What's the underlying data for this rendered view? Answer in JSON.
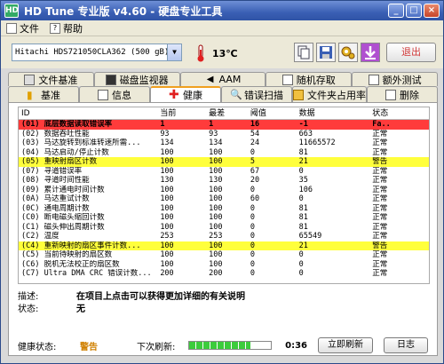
{
  "window": {
    "title": "HD Tune 专业版 v4.60 - 硬盘专业工具",
    "app_icon": "HD"
  },
  "menu": [
    {
      "label": "文件",
      "icon": "file-icon"
    },
    {
      "label": "帮助",
      "icon": "help-icon"
    }
  ],
  "toolbar": {
    "drive": "Hitachi HDS721050CLA362 (500 gB)",
    "temperature": "13℃",
    "exit_label": "退出"
  },
  "tabs_row1": [
    {
      "label": "文件基准",
      "icon": "file-benchmark-icon"
    },
    {
      "label": "磁盘监视器",
      "icon": "disk-monitor-icon"
    },
    {
      "label": "AAM",
      "icon": "speaker-icon"
    },
    {
      "label": "随机存取",
      "icon": "random-access-icon"
    },
    {
      "label": "额外测试",
      "icon": "extra-tests-icon"
    }
  ],
  "tabs_row2": [
    {
      "label": "基准",
      "icon": "benchmark-icon"
    },
    {
      "label": "信息",
      "icon": "info-icon"
    },
    {
      "label": "健康",
      "icon": "health-icon",
      "active": true
    },
    {
      "label": "错误扫描",
      "icon": "error-scan-icon"
    },
    {
      "label": "文件夹占用率",
      "icon": "folder-usage-icon"
    },
    {
      "label": "删除",
      "icon": "erase-icon"
    }
  ],
  "table": {
    "headers": [
      "ID",
      "当前",
      "最差",
      "阈值",
      "数据",
      "状态"
    ],
    "rows": [
      {
        "id": "(01) 底层数据读取错误率",
        "cur": "1",
        "worst": "1",
        "thr": "16",
        "data": "-1",
        "status": "Fa..",
        "hl": "red"
      },
      {
        "id": "(02) 数据吞吐性能",
        "cur": "93",
        "worst": "93",
        "thr": "54",
        "data": "663",
        "status": "正常"
      },
      {
        "id": "(03) 马达旋转到标准转速所需...",
        "cur": "134",
        "worst": "134",
        "thr": "24",
        "data": "11665572",
        "status": "正常"
      },
      {
        "id": "(04) 马达启动/停止计数",
        "cur": "100",
        "worst": "100",
        "thr": "0",
        "data": "81",
        "status": "正常"
      },
      {
        "id": "(05) 重映射扇区计数",
        "cur": "100",
        "worst": "100",
        "thr": "5",
        "data": "21",
        "status": "警告",
        "hl": "yellow"
      },
      {
        "id": "(07) 寻道错误率",
        "cur": "100",
        "worst": "100",
        "thr": "67",
        "data": "0",
        "status": "正常"
      },
      {
        "id": "(08) 寻道时间性能",
        "cur": "130",
        "worst": "130",
        "thr": "20",
        "data": "35",
        "status": "正常"
      },
      {
        "id": "(09) 累计通电时间计数",
        "cur": "100",
        "worst": "100",
        "thr": "0",
        "data": "106",
        "status": "正常"
      },
      {
        "id": "(0A) 马达重试计数",
        "cur": "100",
        "worst": "100",
        "thr": "60",
        "data": "0",
        "status": "正常"
      },
      {
        "id": "(0C) 通电周期计数",
        "cur": "100",
        "worst": "100",
        "thr": "0",
        "data": "81",
        "status": "正常"
      },
      {
        "id": "(C0) 断电磁头缩回计数",
        "cur": "100",
        "worst": "100",
        "thr": "0",
        "data": "81",
        "status": "正常"
      },
      {
        "id": "(C1) 磁头伸出周期计数",
        "cur": "100",
        "worst": "100",
        "thr": "0",
        "data": "81",
        "status": "正常"
      },
      {
        "id": "(C2) 温度",
        "cur": "253",
        "worst": "253",
        "thr": "0",
        "data": "65549",
        "status": "正常"
      },
      {
        "id": "(C4) 重新映射的扇区事件计数...",
        "cur": "100",
        "worst": "100",
        "thr": "0",
        "data": "21",
        "status": "警告",
        "hl": "yellow"
      },
      {
        "id": "(C5) 当前待映射的扇区数",
        "cur": "100",
        "worst": "100",
        "thr": "0",
        "data": "0",
        "status": "正常"
      },
      {
        "id": "(C6) 脱机无法校正的扇区数",
        "cur": "100",
        "worst": "100",
        "thr": "0",
        "data": "0",
        "status": "正常"
      },
      {
        "id": "(C7) Ultra DMA CRC 错误计数...",
        "cur": "200",
        "worst": "200",
        "thr": "0",
        "data": "0",
        "status": "正常"
      }
    ]
  },
  "description": {
    "label": "描述:",
    "value": "在项目上点击可以获得更加详细的有关说明"
  },
  "state": {
    "label": "状态:",
    "value": "无"
  },
  "status_bar": {
    "health_label": "健康状态:",
    "health_value": "警告",
    "refresh_label": "下次刷新:",
    "progress": 0.75,
    "countdown": "0:36",
    "refresh_now_label": "立即刷新",
    "log_label": "日志"
  },
  "colors": {
    "critical_row": "#ff3b3b",
    "warning_row": "#ffff3c",
    "warning_text": "#d08000"
  }
}
